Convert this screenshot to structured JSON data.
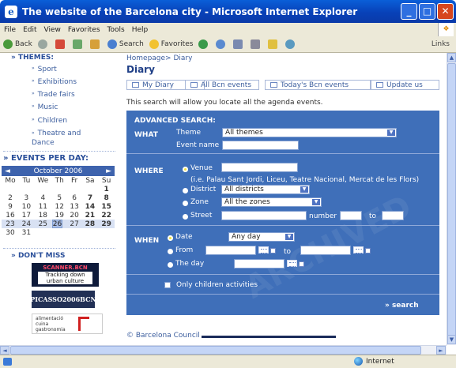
{
  "window": {
    "title": "The website of the Barcelona city - Microsoft Internet Explorer",
    "min": "_",
    "max": "□",
    "close": "✕"
  },
  "menu": [
    "File",
    "Edit",
    "View",
    "Favorites",
    "Tools",
    "Help"
  ],
  "toolbar": {
    "back": "Back",
    "forward": "",
    "search": "Search",
    "favorites": "Favorites",
    "links": "Links"
  },
  "sidebar": {
    "themes_title": "» THEMES:",
    "themes": [
      "Sport",
      "Exhibitions",
      "Trade fairs",
      "Music",
      "Children",
      "Theatre and Dance"
    ],
    "events_title": "» EVENTS PER DAY:",
    "calendar": {
      "month": "October 2006",
      "prev": "◄",
      "next": "►",
      "weekdays": [
        "Mo",
        "Tu",
        "We",
        "Th",
        "Fr",
        "Sa",
        "Su"
      ],
      "weeks": [
        [
          "",
          "",
          "",
          "",
          "",
          "",
          "1"
        ],
        [
          "2",
          "3",
          "4",
          "5",
          "6",
          "7",
          "8"
        ],
        [
          "9",
          "10",
          "11",
          "12",
          "13",
          "14",
          "15"
        ],
        [
          "16",
          "17",
          "18",
          "19",
          "20",
          "21",
          "22"
        ],
        [
          "23",
          "24",
          "25",
          "26",
          "27",
          "28",
          "29"
        ],
        [
          "30",
          "31",
          "",
          "",
          "",
          "",
          ""
        ]
      ]
    },
    "dont_miss_title": "» DON'T MISS",
    "logo1_text": "SCANNER.BCN",
    "logo1_sub": "Tracking down urban culture",
    "logo2_text": "PICASSO2006BCN",
    "logo3_text": "alimentació cuina gastronomia"
  },
  "main": {
    "breadcrumb": "Homepage> Diary",
    "title": "Diary",
    "tabs": [
      "My Diary",
      "All Bcn events",
      "Today's Bcn events",
      "Update us"
    ],
    "intro": "This search will allow you locate all the agenda events.",
    "search": {
      "heading": "ADVANCED SEARCH:",
      "what": {
        "label": "WHAT",
        "theme_label": "Theme",
        "theme_value": "All themes",
        "event_label": "Event name",
        "event_value": ""
      },
      "where": {
        "label": "WHERE",
        "venue_label": "Venue",
        "venue_value": "",
        "venue_hint": "(i.e. Palau Sant Jordi, Liceu, Teatre Nacional, Mercat de les Flors)",
        "district_label": "District",
        "district_value": "All districts",
        "zone_label": "Zone",
        "zone_value": "All the zones",
        "street_label": "Street",
        "number_label": "number",
        "to_label": "to"
      },
      "when": {
        "label": "WHEN",
        "date_label": "Date",
        "date_value": "Any day",
        "from_label": "From",
        "to_label": "to",
        "day_label": "The day"
      },
      "children_label": "Only children activities",
      "submit": "» search"
    },
    "footer": "© Barcelona Council"
  },
  "status": {
    "zone": "Internet"
  }
}
